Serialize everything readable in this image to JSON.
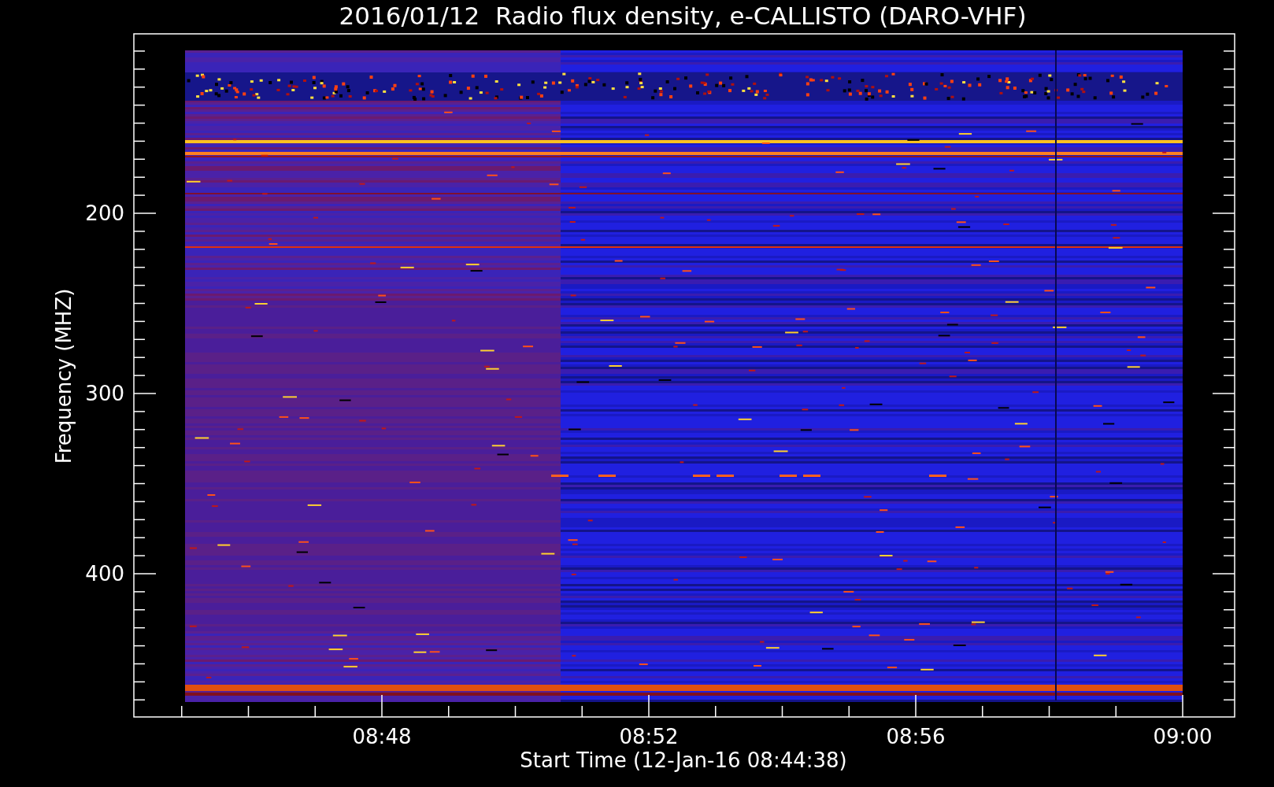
{
  "title": "2016/01/12  Radio flux density, e-CALLISTO (DARO-VHF)",
  "y_axis": {
    "label": "Frequency (MHZ)",
    "tick_labels": [
      "200",
      "300",
      "400"
    ]
  },
  "x_axis": {
    "label": "Start Time (12-Jan-16 08:44:38)",
    "tick_labels": [
      "08:48",
      "08:52",
      "08:56",
      "09:00"
    ]
  }
}
